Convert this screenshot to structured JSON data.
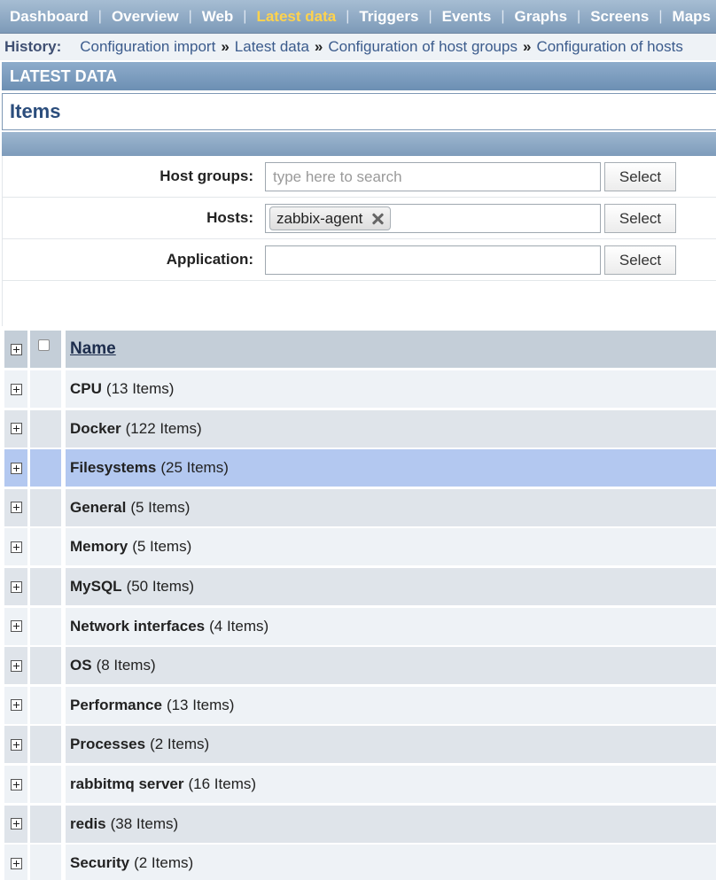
{
  "nav": {
    "items": [
      {
        "label": "Dashboard",
        "active": false
      },
      {
        "label": "Overview",
        "active": false
      },
      {
        "label": "Web",
        "active": false
      },
      {
        "label": "Latest data",
        "active": true
      },
      {
        "label": "Triggers",
        "active": false
      },
      {
        "label": "Events",
        "active": false
      },
      {
        "label": "Graphs",
        "active": false
      },
      {
        "label": "Screens",
        "active": false
      },
      {
        "label": "Maps",
        "active": false
      }
    ],
    "separator": "|",
    "active_color": "#ffd34d"
  },
  "history": {
    "label": "History:",
    "separator": "»",
    "links": [
      "Configuration import",
      "Latest data",
      "Configuration of host groups",
      "Configuration of hosts"
    ]
  },
  "section": {
    "title": "LATEST DATA",
    "subtitle": "Items"
  },
  "filter": {
    "host_groups": {
      "label": "Host groups:",
      "placeholder": "type here to search",
      "button": "Select"
    },
    "hosts": {
      "label": "Hosts:",
      "chip": "zabbix-agent",
      "button": "Select"
    },
    "application": {
      "label": "Application:",
      "value": "",
      "button": "Select"
    }
  },
  "table": {
    "header": {
      "name": "Name"
    },
    "rows": [
      {
        "name": "CPU",
        "count": "(13 Items)",
        "selected": false
      },
      {
        "name": "Docker",
        "count": "(122 Items)",
        "selected": false
      },
      {
        "name": "Filesystems",
        "count": "(25 Items)",
        "selected": true
      },
      {
        "name": "General",
        "count": "(5 Items)",
        "selected": false
      },
      {
        "name": "Memory",
        "count": "(5 Items)",
        "selected": false
      },
      {
        "name": "MySQL",
        "count": "(50 Items)",
        "selected": false
      },
      {
        "name": "Network interfaces",
        "count": "(4 Items)",
        "selected": false
      },
      {
        "name": "OS",
        "count": "(8 Items)",
        "selected": false
      },
      {
        "name": "Performance",
        "count": "(13 Items)",
        "selected": false
      },
      {
        "name": "Processes",
        "count": "(2 Items)",
        "selected": false
      },
      {
        "name": "rabbitmq server",
        "count": "(16 Items)",
        "selected": false
      },
      {
        "name": "redis",
        "count": "(38 Items)",
        "selected": false
      },
      {
        "name": "Security",
        "count": "(2 Items)",
        "selected": false
      }
    ]
  },
  "icons": {
    "expand": "plus-square-icon",
    "remove": "close-icon"
  },
  "colors": {
    "header_bar": "#7d9ab8",
    "selected_row": "#b3c8f0",
    "link": "#3b5b8c"
  }
}
